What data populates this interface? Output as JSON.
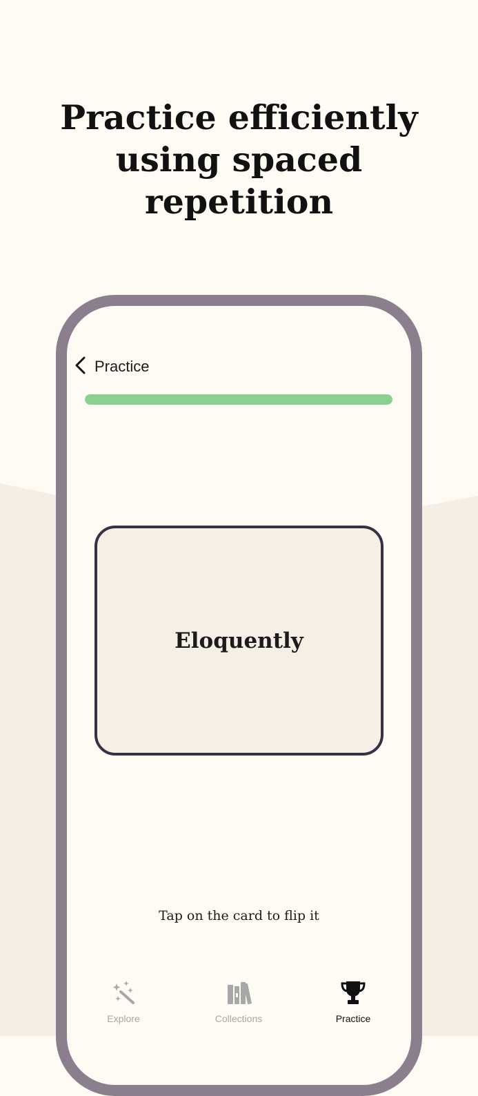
{
  "headline": {
    "line1": "Practice efficiently",
    "line2": "using spaced",
    "line3": "repetition"
  },
  "colors": {
    "page_background": "#fdfbf4",
    "lower_wave": "#f5eee4",
    "phone_frame": "#8b7f8d",
    "progress": "#8ad08e",
    "card_border": "#3b2f46",
    "card_fill": "#f5efe6",
    "tab_inactive": "#a7a7a7",
    "tab_active": "#111111"
  },
  "screen": {
    "nav": {
      "back_icon": "chevron-left-icon",
      "title": "Practice"
    },
    "progress": {
      "value": 1.0
    },
    "card": {
      "word": "Eloquently"
    },
    "hint": "Tap on the card to flip it",
    "tabs": [
      {
        "label": "Explore",
        "icon": "magic-wand-icon",
        "active": false
      },
      {
        "label": "Collections",
        "icon": "books-icon",
        "active": false
      },
      {
        "label": "Practice",
        "icon": "trophy-icon",
        "active": true
      }
    ]
  }
}
